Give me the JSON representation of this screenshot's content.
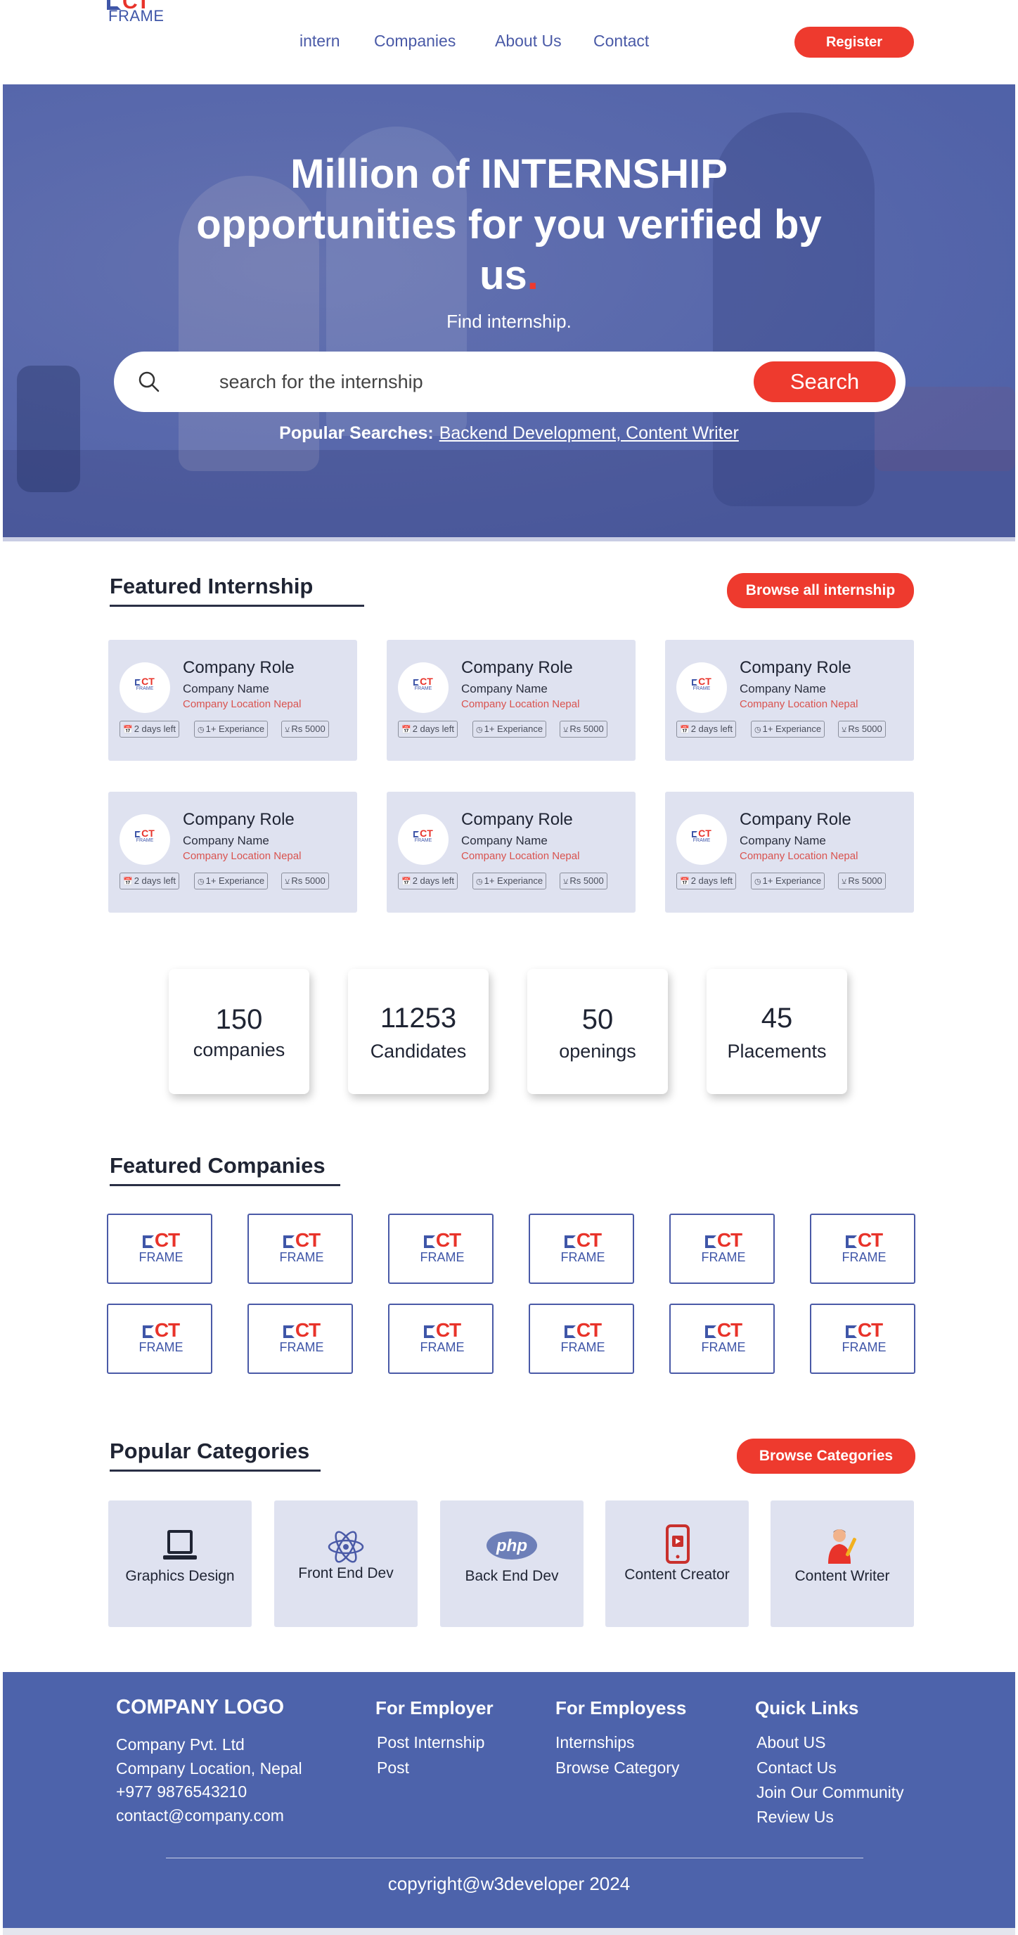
{
  "header": {
    "logo": {
      "ct": "CT",
      "frame": "FRAME"
    },
    "nav": [
      "intern",
      "Companies",
      "About Us",
      "Contact"
    ],
    "register_label": "Register"
  },
  "hero": {
    "title": "Million of INTERNSHIP opportunities for you verified by us",
    "title_dot": ".",
    "subtitle": "Find  internship.",
    "search_placeholder": "search for the internship",
    "search_button": "Search",
    "popular_label": "Popular Searches:",
    "popular_values": "Backend Development, Content Writer"
  },
  "featured_internship": {
    "title": "Featured Internship",
    "browse_label": "Browse all internship",
    "cards": [
      {
        "role": "Company Role",
        "name": "Company Name",
        "location": "Company Location Nepal",
        "days": "2 days left",
        "experience": "1+ Experiance",
        "stipend": "Rs 5000"
      },
      {
        "role": "Company Role",
        "name": "Company Name",
        "location": "Company Location Nepal",
        "days": "2 days left",
        "experience": "1+ Experiance",
        "stipend": "Rs 5000"
      },
      {
        "role": "Company Role",
        "name": "Company Name",
        "location": "Company Location Nepal",
        "days": "2 days left",
        "experience": "1+ Experiance",
        "stipend": "Rs 5000"
      },
      {
        "role": "Company Role",
        "name": "Company Name",
        "location": "Company Location Nepal",
        "days": "2 days left",
        "experience": "1+ Experiance",
        "stipend": "Rs 5000"
      },
      {
        "role": "Company Role",
        "name": "Company Name",
        "location": "Company Location Nepal",
        "days": "2 days left",
        "experience": "1+ Experiance",
        "stipend": "Rs 5000"
      },
      {
        "role": "Company Role",
        "name": "Company Name",
        "location": "Company Location Nepal",
        "days": "2 days left",
        "experience": "1+ Experiance",
        "stipend": "Rs 5000"
      }
    ]
  },
  "stats": [
    {
      "value": "150",
      "label": "companies"
    },
    {
      "value": "11253",
      "label": "Candidates"
    },
    {
      "value": "50",
      "label": "openings"
    },
    {
      "value": "45",
      "label": "Placements"
    }
  ],
  "featured_companies": {
    "title": "Featured Companies",
    "logo_ct": "CT",
    "logo_frame": "FRAME"
  },
  "categories": {
    "title": "Popular Categories",
    "browse_label": "Browse Categories",
    "items": [
      {
        "label": "Graphics Design",
        "icon": "laptop-icon"
      },
      {
        "label": "Front End Dev",
        "icon": "react-atom-icon"
      },
      {
        "label": "Back End Dev",
        "icon": "php-icon"
      },
      {
        "label": "Content Creator",
        "icon": "smartphone-play-icon"
      },
      {
        "label": "Content Writer",
        "icon": "writer-person-icon"
      }
    ]
  },
  "footer": {
    "brand": "COMPANY LOGO",
    "company": [
      "Company Pvt. Ltd",
      "Company Location, Nepal",
      "+977 9876543210",
      "contact@company.com"
    ],
    "employer_title": "For Employer",
    "employer_links": [
      "Post Internship",
      "Post"
    ],
    "employee_title": "For Employess",
    "employee_links": [
      "Internships",
      "Browse Category"
    ],
    "quick_title": "Quick Links",
    "quick_links": [
      "About US",
      "Contact Us",
      "Join Our Community",
      "Review Us"
    ],
    "copyright": "copyright@w3developer 2024"
  },
  "colors": {
    "primary": "#4d63ab",
    "accent": "#ee3a2e",
    "card_bg": "#dfe2f0"
  }
}
